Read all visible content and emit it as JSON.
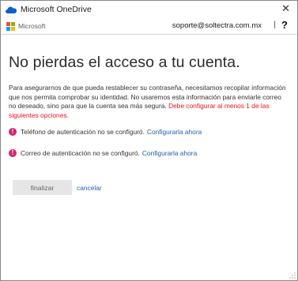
{
  "window": {
    "title": "Microsoft OneDrive",
    "close_glyph": "✕"
  },
  "header": {
    "brand": "Microsoft",
    "brand_colors": [
      "#f25022",
      "#7fba00",
      "#00a4ef",
      "#ffb900"
    ],
    "account_email": "soporte@soltectra.com.mx",
    "separator": "|",
    "help_label": "?"
  },
  "main": {
    "heading": "No pierdas el acceso a tu cuenta.",
    "description": "Para asegurarnos de que pueda restablecer su contraseña, necesitamos recopilar información que nos permita comprobar su identidad. No usaremos esta información para enviarle correo no deseado, sino para que la cuenta sea más segura.",
    "requirement": "Debe configurar al menos 1 de las siguientes opciones.",
    "items": [
      {
        "text": "Teléfono de autenticación no se configuró.",
        "link": "Configurarla ahora",
        "icon": "!"
      },
      {
        "text": "Correo de autenticación no se configuró.",
        "link": "Configurarla ahora",
        "icon": "!"
      }
    ],
    "finish_label": "finalizar",
    "cancel_label": "cancelar"
  },
  "colors": {
    "warning": "#d6246e",
    "link": "#1f5fa8",
    "requirement": "#e81123"
  }
}
